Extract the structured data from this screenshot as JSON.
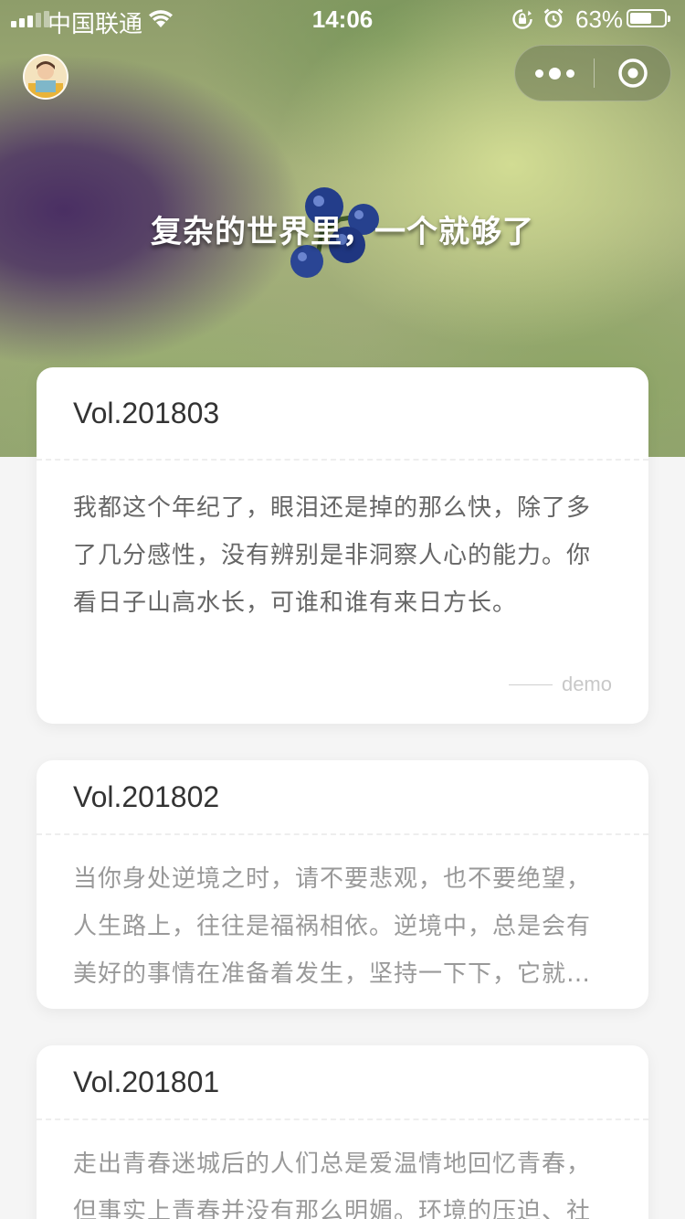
{
  "status_bar": {
    "carrier": "中国联通",
    "time": "14:06",
    "battery_percent": "63%",
    "battery_level": 0.63,
    "icons": [
      "signal-icon",
      "wifi-icon",
      "orientation-lock-icon",
      "alarm-icon",
      "battery-icon"
    ]
  },
  "header": {
    "avatar_icon": "user-avatar",
    "capsule": {
      "more_icon": "more-dots-icon",
      "close_icon": "target-close-icon"
    }
  },
  "hero": {
    "title": "复杂的世界里，一个就够了"
  },
  "cards": [
    {
      "vol": "Vol.201803",
      "text": "我都这个年纪了，眼泪还是掉的那么快，除了多了几分感性，没有辨别是非洞察人心的能力。你看日子山高水长，可谁和谁有来日方长。",
      "author": "demo"
    },
    {
      "vol": "Vol.201802",
      "text": "当你身处逆境之时，请不要悲观，也不要绝望，人生路上，往往是福祸相依。逆境中，总是会有美好的事情在准备着发生，坚持一下下，它就…"
    },
    {
      "vol": "Vol.201801",
      "text": "走出青春迷城后的人们总是爱温情地回忆青春，但事实上青春并没有那么明媚。环境的压迫、社"
    }
  ],
  "colors": {
    "page_background": "#f5f5f5",
    "card_background": "#ffffff",
    "title_text": "#333333",
    "body_text": "#666666",
    "muted_text": "#999999"
  }
}
